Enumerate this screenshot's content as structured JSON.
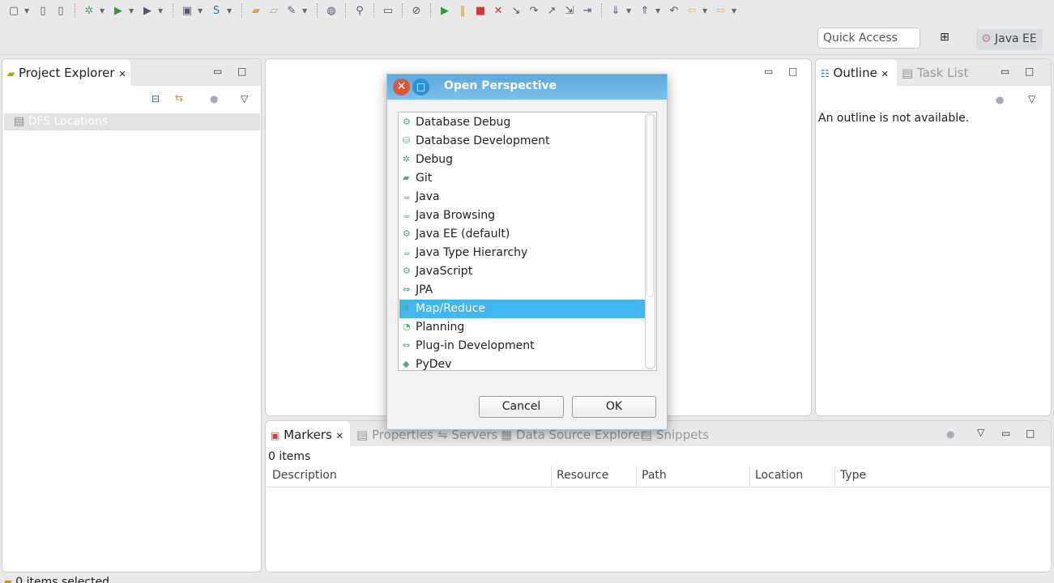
{
  "toolbar": {
    "icons": [
      "new-icon",
      "save-icon",
      "save-all-icon",
      "debug-icon",
      "run-icon",
      "run-external-icon",
      "new-server-icon",
      "new-service-icon",
      "open-project-icon",
      "open-folder-icon",
      "build-icon",
      "web-browser-icon",
      "java-search-icon",
      "console-icon",
      "skip-breakpoints-icon",
      "resume-icon",
      "suspend-icon",
      "terminate-icon",
      "disconnect-icon",
      "step-into-icon",
      "step-over-icon",
      "step-return-icon",
      "drop-to-frame-icon",
      "use-step-filters-icon",
      "next-annotation-icon",
      "previous-annotation-icon",
      "last-edit-icon",
      "back-icon",
      "forward-icon"
    ]
  },
  "quick_access": {
    "placeholder": "Quick Access"
  },
  "perspective": {
    "current": "Java EE"
  },
  "project_explorer": {
    "title": "Project Explorer",
    "items": [
      {
        "label": "DFS Locations"
      }
    ]
  },
  "outline": {
    "title": "Outline",
    "other_tab": "Task List",
    "message": "An outline is not available."
  },
  "bottom": {
    "tabs": [
      "Markers",
      "Properties",
      "Servers",
      "Data Source Explorer",
      "Snippets"
    ],
    "count": "0 items",
    "columns": [
      "Description",
      "Resource",
      "Path",
      "Location",
      "Type"
    ]
  },
  "dialog": {
    "title": "Open Perspective",
    "items": [
      "Database Debug",
      "Database Development",
      "Debug",
      "Git",
      "Java",
      "Java Browsing",
      "Java EE (default)",
      "Java Type Hierarchy",
      "JavaScript",
      "JPA",
      "Map/Reduce",
      "Planning",
      "Plug-in Development",
      "PyDev"
    ],
    "selected": "Map/Reduce",
    "cancel": "Cancel",
    "ok": "OK"
  },
  "status": {
    "text": "0 items selected"
  },
  "colors": {
    "selection": "#41b6ee",
    "title_bar": "#6bb5e6"
  }
}
